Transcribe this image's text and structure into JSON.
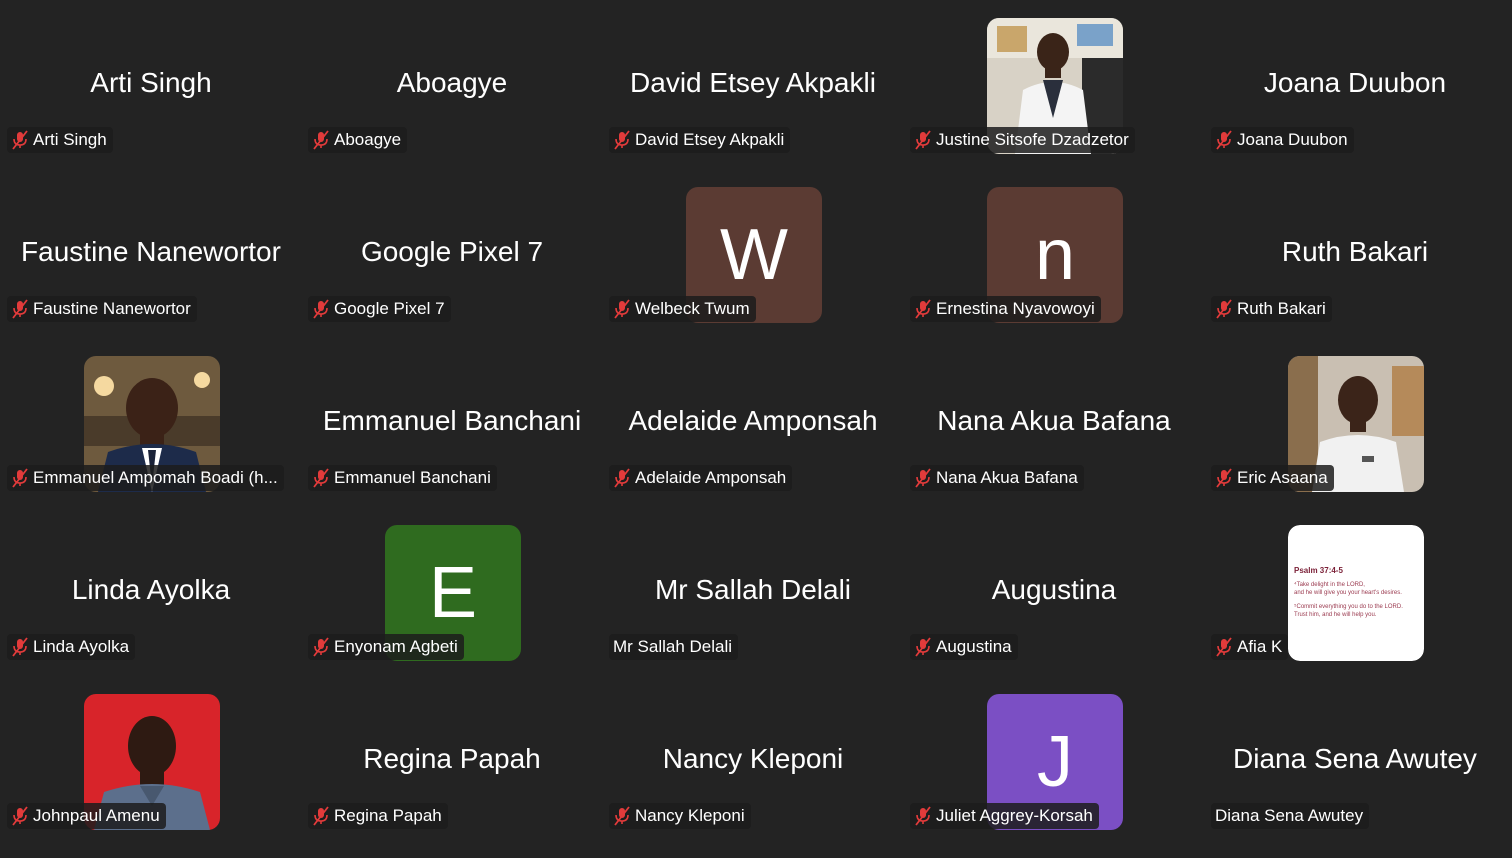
{
  "meeting": {
    "participants": [
      {
        "name": "Arti Singh",
        "label": "Arti Singh",
        "muted": true,
        "avatar": "none"
      },
      {
        "name": "Aboagye",
        "label": "Aboagye",
        "muted": true,
        "avatar": "none"
      },
      {
        "name": "David Etsey Akpakli",
        "label": "David Etsey Akpakli",
        "muted": true,
        "avatar": "none"
      },
      {
        "name": "Justine Sitsofe Dzadzetor",
        "label": "Justine Sitsofe Dzadzetor",
        "muted": true,
        "avatar": "photo"
      },
      {
        "name": "Joana Duubon",
        "label": "Joana Duubon",
        "muted": true,
        "avatar": "none"
      },
      {
        "name": "Faustine Nanewortor",
        "label": "Faustine Nanewortor",
        "muted": true,
        "avatar": "none"
      },
      {
        "name": "Google Pixel 7",
        "label": "Google Pixel 7",
        "muted": true,
        "avatar": "none"
      },
      {
        "name": "Welbeck Twum",
        "label": "Welbeck Twum",
        "muted": true,
        "avatar": "letter",
        "letter": "W",
        "color": "#5b3b33"
      },
      {
        "name": "Ernestina Nyavowoyi",
        "label": "Ernestina Nyavowoyi",
        "muted": true,
        "avatar": "letter",
        "letter": "n",
        "color": "#5b3b33"
      },
      {
        "name": "Ruth Bakari",
        "label": "Ruth Bakari",
        "muted": true,
        "avatar": "none"
      },
      {
        "name": "Emmanuel Ampomah Boadi (h...",
        "label": "Emmanuel Ampomah Boadi (h...",
        "muted": true,
        "avatar": "photo"
      },
      {
        "name": "Emmanuel Banchani",
        "label": "Emmanuel Banchani",
        "muted": true,
        "avatar": "none"
      },
      {
        "name": "Adelaide Amponsah",
        "label": "Adelaide Amponsah",
        "muted": true,
        "avatar": "none"
      },
      {
        "name": "Nana Akua Bafana",
        "label": "Nana Akua Bafana",
        "muted": true,
        "avatar": "none"
      },
      {
        "name": "Eric Asaana",
        "label": "Eric Asaana",
        "muted": true,
        "avatar": "photo"
      },
      {
        "name": "Linda Ayolka",
        "label": "Linda Ayolka",
        "muted": true,
        "avatar": "none"
      },
      {
        "name": "Enyonam Agbeti",
        "label": "Enyonam Agbeti",
        "muted": true,
        "avatar": "letter",
        "letter": "E",
        "color": "#2f6b1f"
      },
      {
        "name": "Mr Sallah Delali",
        "label": "Mr Sallah Delali",
        "muted": false,
        "avatar": "none"
      },
      {
        "name": "Augustina",
        "label": "Augustina",
        "muted": true,
        "avatar": "none"
      },
      {
        "name": "Afia K",
        "label": "Afia K",
        "muted": true,
        "avatar": "psalm"
      },
      {
        "name": "Johnpaul Amenu",
        "label": "Johnpaul Amenu",
        "muted": true,
        "avatar": "photo"
      },
      {
        "name": "Regina Papah",
        "label": "Regina Papah",
        "muted": true,
        "avatar": "none"
      },
      {
        "name": "Nancy Kleponi",
        "label": "Nancy Kleponi",
        "muted": true,
        "avatar": "none"
      },
      {
        "name": "Juliet Aggrey-Korsah",
        "label": "Juliet Aggrey-Korsah",
        "muted": true,
        "avatar": "letter",
        "letter": "J",
        "color": "#7b4fc4"
      },
      {
        "name": "Diana Sena Awutey",
        "label": "Diana Sena Awutey",
        "muted": false,
        "avatar": "none"
      }
    ],
    "psalm_card": {
      "title": "Psalm 37:4-5",
      "lines": [
        "⁴Take delight in the LORD,",
        "and he will give you your heart's desires.",
        "⁵Commit everything you do to the LORD.",
        "Trust him, and he will help you."
      ]
    },
    "icons": {
      "muted": "mic-off-icon"
    },
    "colors": {
      "mute_red": "#e23b3b",
      "background": "#232323"
    }
  }
}
